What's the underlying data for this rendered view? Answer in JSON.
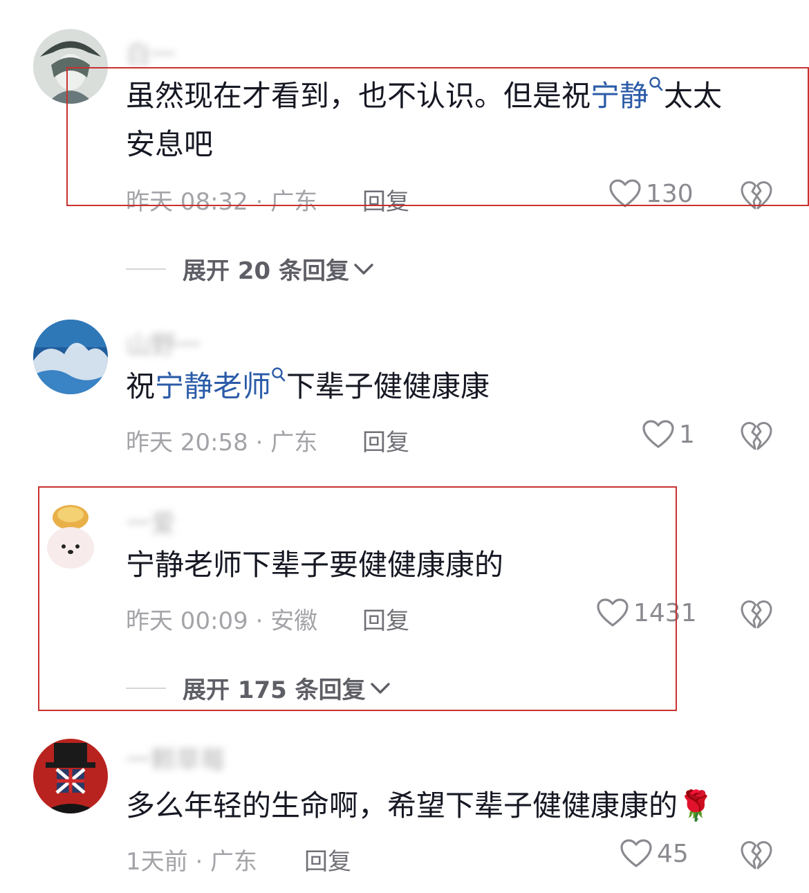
{
  "comments": [
    {
      "username": "白一",
      "text_before": "虽然现在才看到，也不认识。但是祝",
      "mention": "宁静",
      "text_after_line1": "太太",
      "text_line2": "安息吧",
      "meta": "昨天 08:32 · 广东",
      "reply_label": "回复",
      "likes": "130",
      "expand_label": "展开 20 条回复"
    },
    {
      "username": "山野一",
      "text_before": "祝",
      "mention": "宁静老师",
      "text_after": "下辈子健健康康",
      "meta": "昨天 20:58 · 广东",
      "reply_label": "回复",
      "likes": "1"
    },
    {
      "username": "一爱",
      "text": "宁静老师下辈子要健健康康的",
      "meta": "昨天 00:09 · 安徽",
      "reply_label": "回复",
      "likes": "1431",
      "expand_label": "展开 175 条回复"
    },
    {
      "username": "一颗草莓",
      "text": "多么年轻的生命啊，希望下辈子健健康康的",
      "emoji": "🌹",
      "meta": "1天前 · 广东",
      "reply_label": "回复",
      "likes": "45"
    }
  ],
  "icons": {
    "like": "heart-outline-icon",
    "dislike": "broken-heart-icon",
    "expand": "chevron-down-icon",
    "mention_search": "search-icon"
  },
  "colors": {
    "mention": "#2b5ba8",
    "highlight_box": "#c8312f",
    "meta_text": "#a3a3a8"
  }
}
